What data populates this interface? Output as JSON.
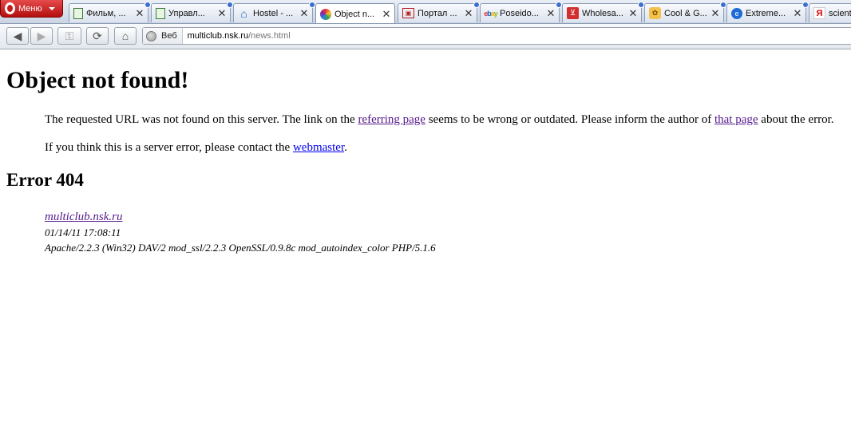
{
  "browser": {
    "menu_label": "Меню",
    "tabs": [
      {
        "title": "Фильм, ...",
        "icon": "document-icon",
        "active": false
      },
      {
        "title": "Управл...",
        "icon": "document-icon",
        "active": false
      },
      {
        "title": "Hostel - ...",
        "icon": "home-icon",
        "active": false
      },
      {
        "title": "Object n...",
        "icon": "color-wheel-icon",
        "active": true
      },
      {
        "title": "Портал ...",
        "icon": "portal-icon",
        "active": false
      },
      {
        "title": "Poseido...",
        "icon": "ebay-icon",
        "active": false
      },
      {
        "title": "Wholesa...",
        "icon": "cart-icon",
        "active": false
      },
      {
        "title": "Cool & G...",
        "icon": "cool-icon",
        "active": false
      },
      {
        "title": "Extreme...",
        "icon": "globe-icon",
        "active": false
      },
      {
        "title": "scient",
        "icon": "yandex-icon",
        "active": false
      }
    ],
    "address": {
      "site_label": "Веб",
      "url_host": "multiclub.nsk.ru",
      "url_path": "/news.html"
    }
  },
  "page": {
    "heading": "Object not found!",
    "para1": {
      "text_before": "The requested URL was not found on this server. The link on the ",
      "link1": "referring page",
      "text_middle": " seems to be wrong or outdated. Please inform the author of ",
      "link2": "that page",
      "text_after": " about the error."
    },
    "para2": {
      "text_before": "If you think this is a server error, please contact the ",
      "link": "webmaster",
      "text_after": "."
    },
    "error_heading": "Error 404",
    "server_info": {
      "host": "multiclub.nsk.ru",
      "timestamp": "01/14/11 17:08:11",
      "software": "Apache/2.2.3 (Win32) DAV/2 mod_ssl/2.2.3 OpenSSL/0.9.8c mod_autoindex_color PHP/5.1.6"
    }
  }
}
